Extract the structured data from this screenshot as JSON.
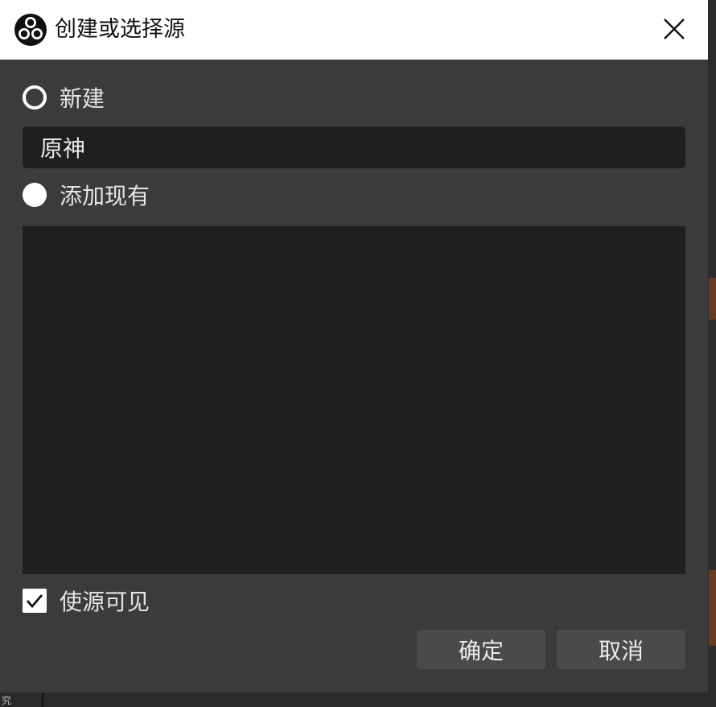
{
  "window": {
    "title": "创建或选择源",
    "icon": "obs-logo-icon",
    "close_icon": "close-icon"
  },
  "options": {
    "new_label": "新建",
    "new_selected": false,
    "name_value": "原神",
    "existing_label": "添加现有",
    "existing_selected": true,
    "existing_list": []
  },
  "visible": {
    "label": "使源可见",
    "checked": true
  },
  "buttons": {
    "ok": "确定",
    "cancel": "取消"
  },
  "background": {
    "partial_text": "究"
  }
}
